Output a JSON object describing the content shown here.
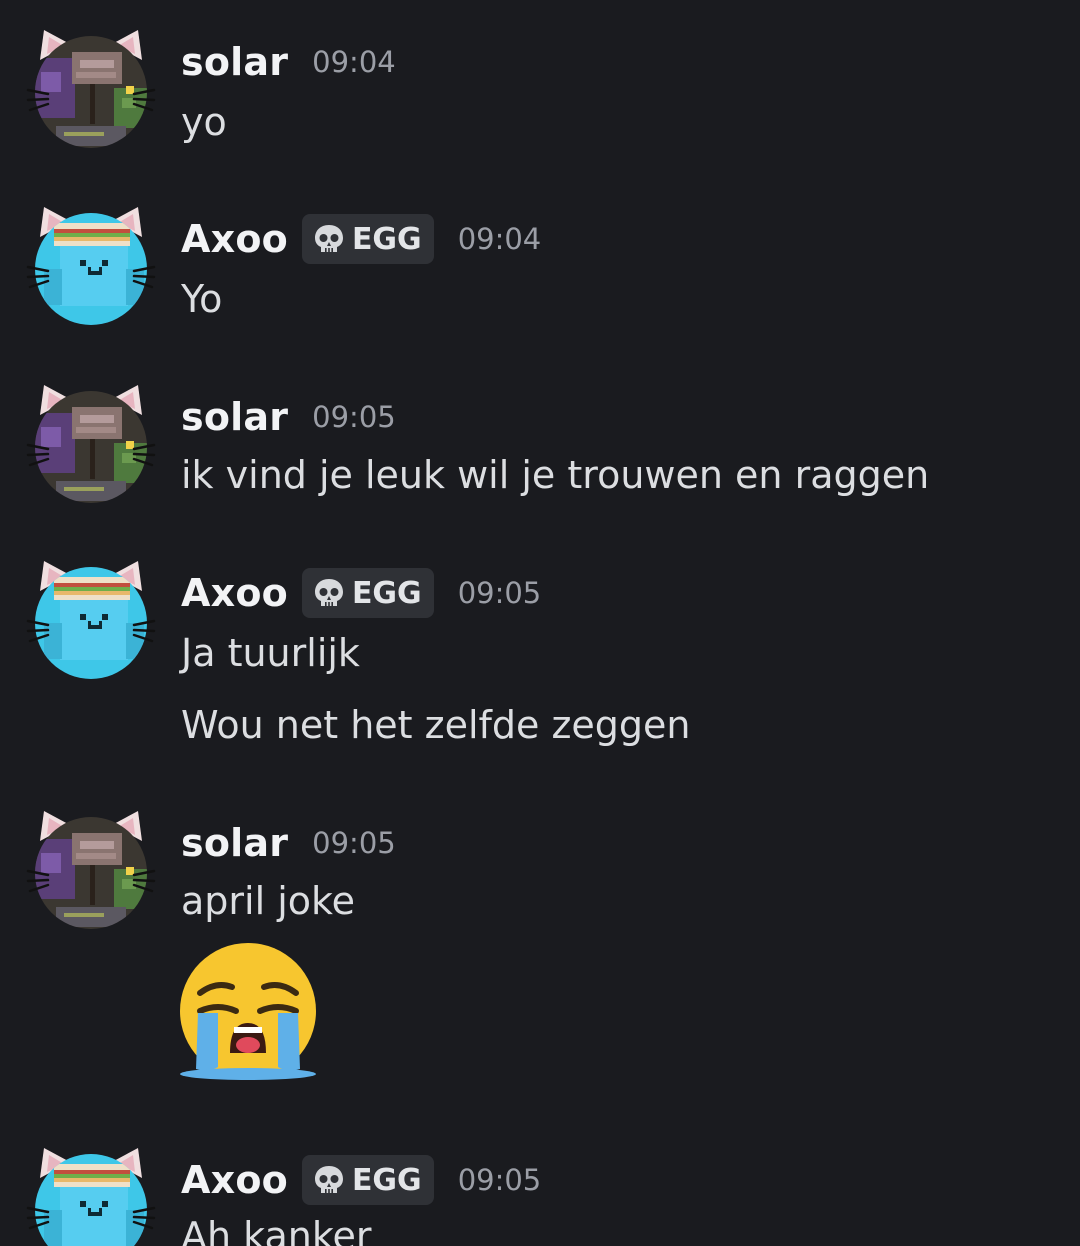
{
  "messages": [
    {
      "username": "solar",
      "time": "09:04",
      "lines": [
        "yo"
      ]
    },
    {
      "username": "Axoo",
      "badge": "EGG",
      "time": "09:04",
      "lines": [
        "Yo"
      ]
    },
    {
      "username": "solar",
      "time": "09:05",
      "lines": [
        "ik vind je leuk wil je trouwen en raggen"
      ]
    },
    {
      "username": "Axoo",
      "badge": "EGG",
      "time": "09:05",
      "lines": [
        "Ja tuurlijk",
        "Wou net het zelfde zeggen"
      ]
    },
    {
      "username": "solar",
      "time": "09:05",
      "lines": [
        "april joke"
      ],
      "emoji": "loudly-crying-face"
    },
    {
      "username": "Axoo",
      "badge": "EGG",
      "time": "09:05",
      "lines": [
        "Ah kanker"
      ]
    }
  ],
  "colors": {
    "background": "#1a1b1f",
    "username": "#f2f3f5",
    "text": "#dcdee1",
    "timestamp": "#9b9ea6",
    "badge_bg": "#2f3136"
  }
}
